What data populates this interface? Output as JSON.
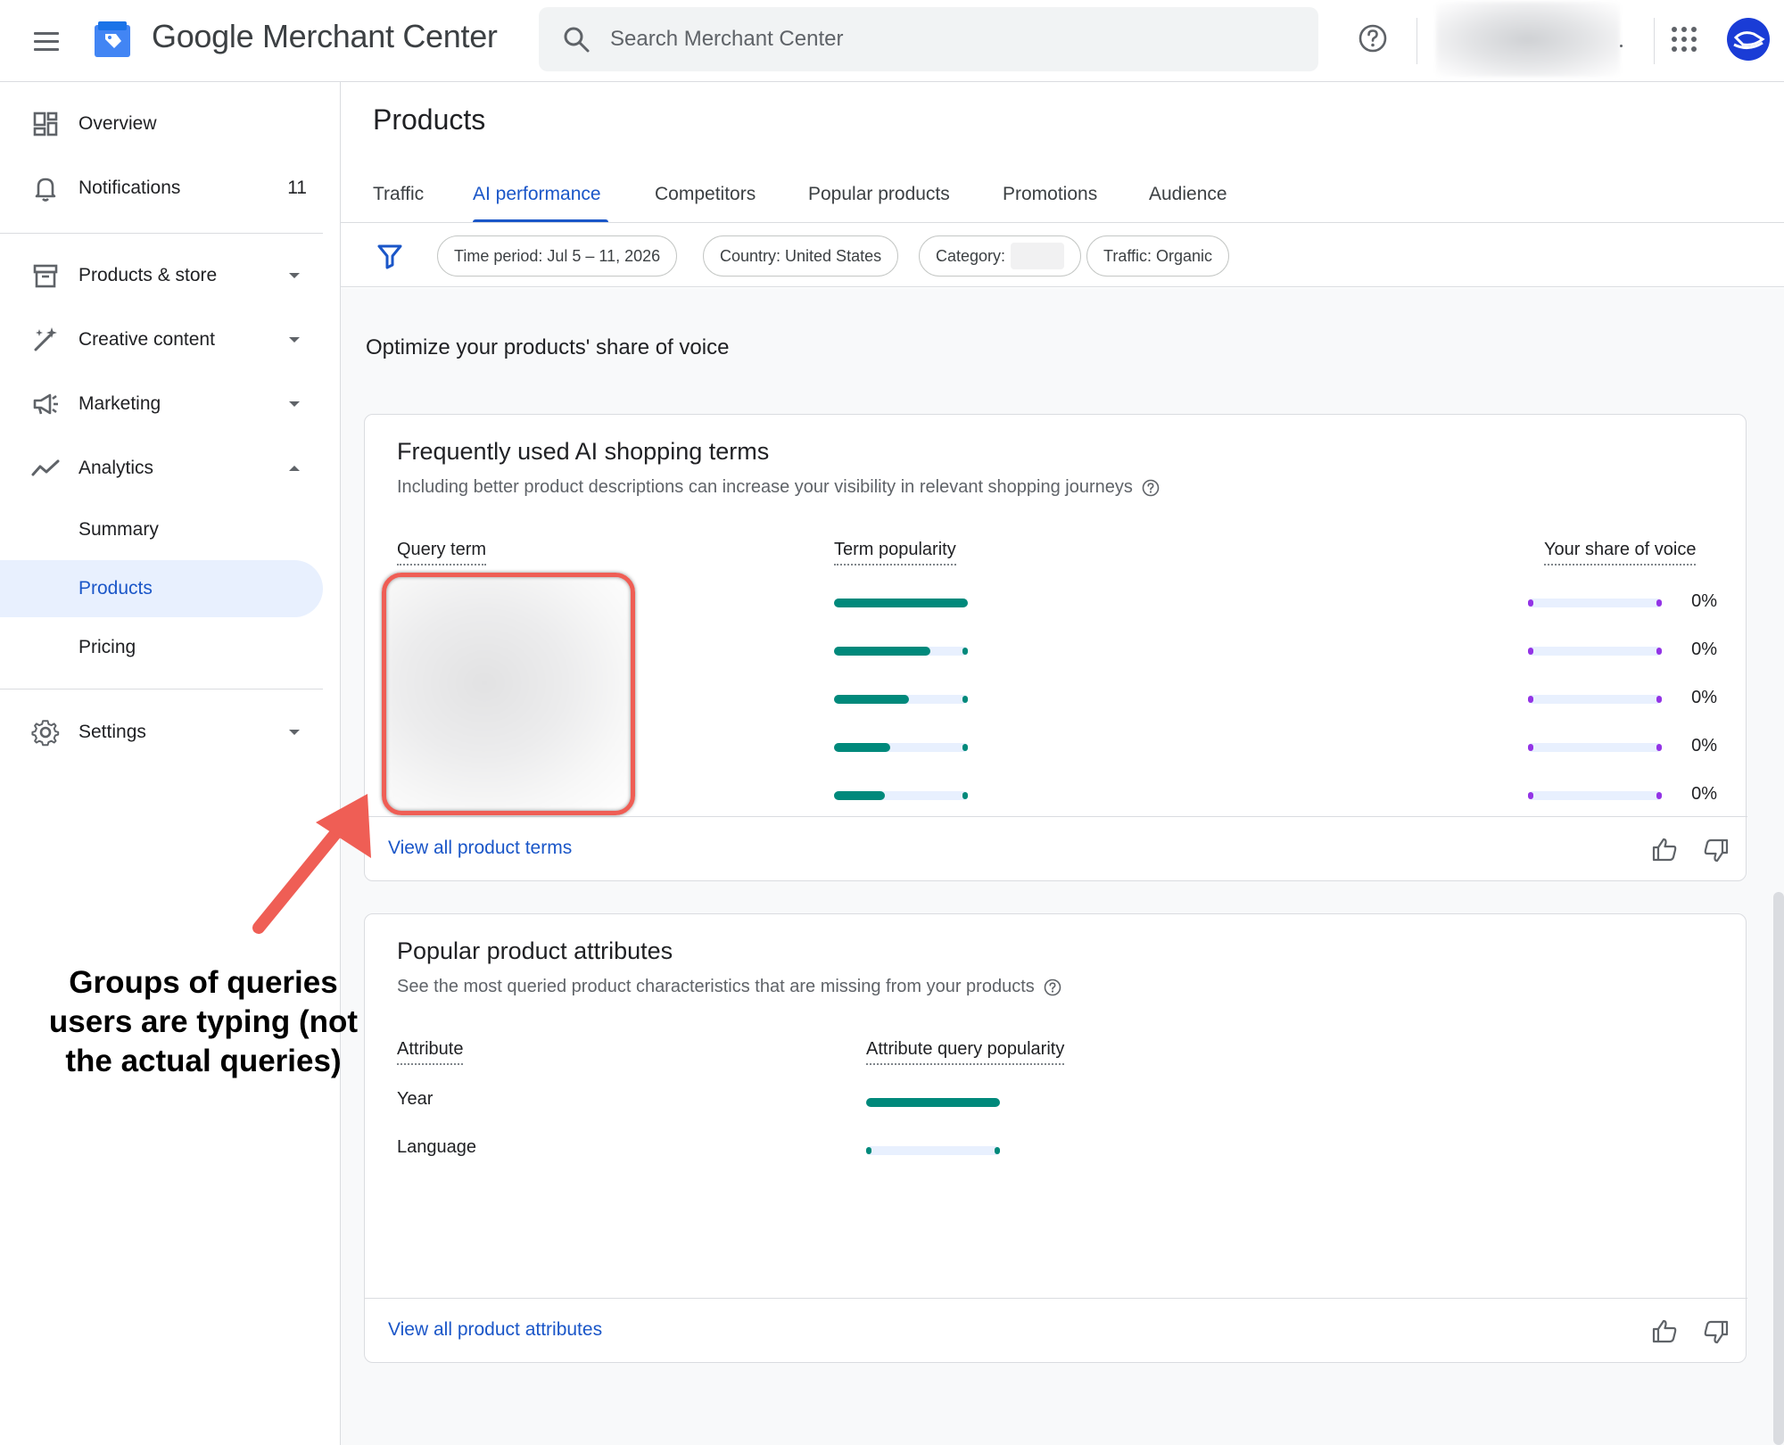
{
  "header": {
    "app_title": "Google Merchant Center",
    "search_placeholder": "Search Merchant Center",
    "brand_color": "#1a73e8"
  },
  "sidebar": {
    "overview": "Overview",
    "notifications": {
      "label": "Notifications",
      "count": "11"
    },
    "products_store": "Products & store",
    "creative_content": "Creative content",
    "marketing": "Marketing",
    "analytics": "Analytics",
    "analytics_items": [
      "Summary",
      "Products",
      "Pricing"
    ],
    "settings": "Settings",
    "active_item": "Products"
  },
  "page": {
    "title": "Products",
    "tabs": [
      "Traffic",
      "AI performance",
      "Competitors",
      "Popular products",
      "Promotions",
      "Audience"
    ],
    "active_tab": "AI performance"
  },
  "filters": {
    "time_period": "Time period: Jul 5 – 11, 2026",
    "country": "Country: United States",
    "category": "Category:",
    "traffic": "Traffic: Organic"
  },
  "section_title": "Optimize your products' share of voice",
  "ai_terms_card": {
    "title": "Frequently used AI shopping terms",
    "subtitle": "Including better product descriptions can increase your visibility in relevant shopping journeys",
    "col_query": "Query term",
    "col_popularity": "Term popularity",
    "col_share": "Your share of voice",
    "rows": [
      {
        "popularity": 1.0,
        "share": "0%"
      },
      {
        "popularity": 0.72,
        "share": "0%"
      },
      {
        "popularity": 0.56,
        "share": "0%"
      },
      {
        "popularity": 0.42,
        "share": "0%"
      },
      {
        "popularity": 0.38,
        "share": "0%"
      }
    ],
    "link": "View all product terms"
  },
  "attributes_card": {
    "title": "Popular product attributes",
    "subtitle": "See the most queried product characteristics that are missing from your products",
    "col_attribute": "Attribute",
    "col_popularity": "Attribute query popularity",
    "rows": [
      {
        "label": "Year",
        "popularity": 1.0
      },
      {
        "label": "Language",
        "popularity": 0.0
      }
    ],
    "link": "View all product attributes"
  },
  "annotation": {
    "text": "Groups of queries users are typing (not the actual queries)",
    "color": "#ef5e55"
  },
  "colors": {
    "accent": "#1a56c8",
    "bar": "#00897b",
    "share_dot": "#9334e6"
  }
}
